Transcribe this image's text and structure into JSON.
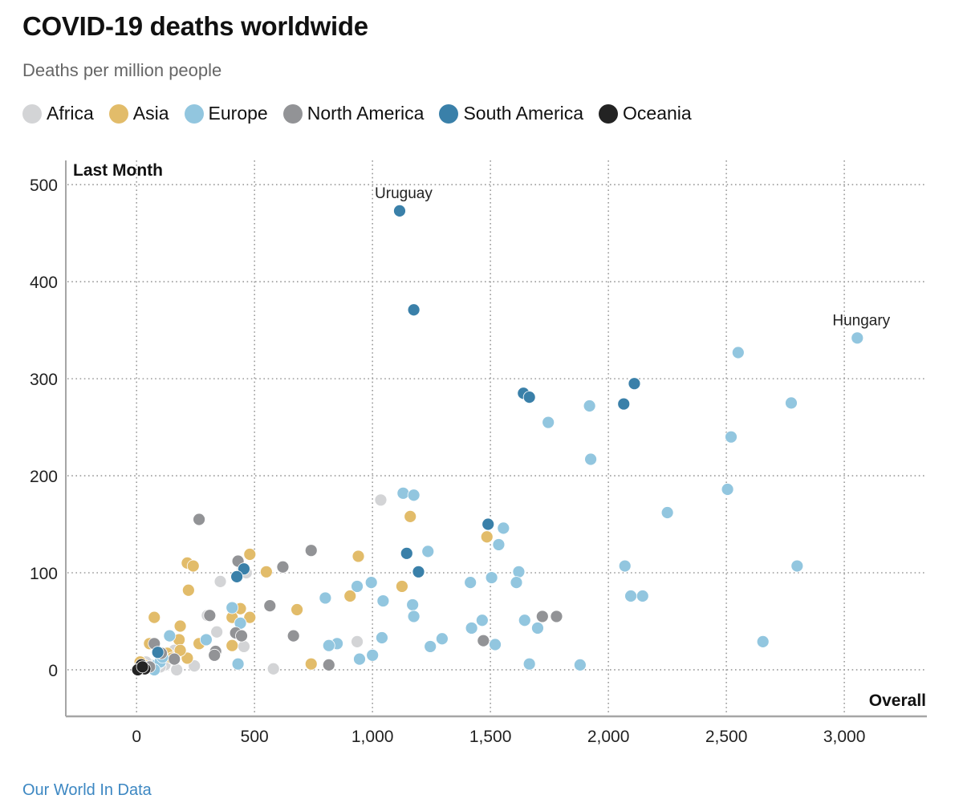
{
  "header": {
    "title": "COVID-19 deaths worldwide",
    "subtitle": "Deaths per million people"
  },
  "legend": [
    {
      "label": "Africa",
      "color": "#d3d4d6"
    },
    {
      "label": "Asia",
      "color": "#e2bc6a"
    },
    {
      "label": "Europe",
      "color": "#92c6df"
    },
    {
      "label": "North America",
      "color": "#929396"
    },
    {
      "label": "South America",
      "color": "#3a80a9"
    },
    {
      "label": "Oceania",
      "color": "#232323"
    }
  ],
  "source": "Our World In Data",
  "chart_data": {
    "type": "scatter",
    "title": "COVID-19 deaths worldwide",
    "subtitle": "Deaths per million people",
    "xlabel": "Overall",
    "ylabel": "Last Month",
    "xlim": [
      -300,
      3350
    ],
    "ylim": [
      -48,
      525
    ],
    "xticks": [
      0,
      500,
      1000,
      1500,
      2000,
      2500,
      3000
    ],
    "xtick_labels": [
      "0",
      "500",
      "1,000",
      "1,500",
      "2,000",
      "2,500",
      "3,000"
    ],
    "yticks": [
      0,
      100,
      200,
      300,
      400,
      500
    ],
    "ytick_labels": [
      "0",
      "100",
      "200",
      "300",
      "400",
      "500"
    ],
    "grid": true,
    "legend_position": "top-left",
    "annotations": [
      {
        "label": "Uruguay",
        "x": 1115,
        "y": 473
      },
      {
        "label": "Hungary",
        "x": 3055,
        "y": 342
      }
    ],
    "series": [
      {
        "name": "Africa",
        "color": "#d3d4d6",
        "points": [
          [
            1035,
            175
          ],
          [
            355,
            91
          ],
          [
            465,
            100
          ],
          [
            450,
            104
          ],
          [
            340,
            39
          ],
          [
            300,
            56
          ],
          [
            455,
            24
          ],
          [
            935,
            29
          ],
          [
            580,
            1
          ],
          [
            160,
            20
          ],
          [
            245,
            4
          ],
          [
            170,
            0
          ],
          [
            120,
            5
          ],
          [
            60,
            5
          ],
          [
            40,
            8
          ],
          [
            150,
            14
          ],
          [
            100,
            3
          ]
        ]
      },
      {
        "name": "Asia",
        "color": "#e2bc6a",
        "points": [
          [
            215,
            110
          ],
          [
            240,
            107
          ],
          [
            220,
            82
          ],
          [
            480,
            119
          ],
          [
            940,
            117
          ],
          [
            1160,
            158
          ],
          [
            1485,
            137
          ],
          [
            550,
            101
          ],
          [
            1125,
            86
          ],
          [
            905,
            76
          ],
          [
            440,
            63
          ],
          [
            405,
            54
          ],
          [
            480,
            54
          ],
          [
            680,
            62
          ],
          [
            185,
            45
          ],
          [
            75,
            54
          ],
          [
            55,
            27
          ],
          [
            265,
            27
          ],
          [
            405,
            25
          ],
          [
            180,
            31
          ],
          [
            740,
            6
          ],
          [
            215,
            12
          ],
          [
            185,
            20
          ],
          [
            130,
            17
          ],
          [
            30,
            5
          ],
          [
            15,
            8
          ],
          [
            60,
            3
          ],
          [
            95,
            7
          ],
          [
            150,
            12
          ]
        ]
      },
      {
        "name": "Europe",
        "color": "#92c6df",
        "points": [
          [
            3055,
            342
          ],
          [
            2550,
            327
          ],
          [
            2775,
            275
          ],
          [
            1920,
            272
          ],
          [
            1745,
            255
          ],
          [
            2520,
            240
          ],
          [
            1925,
            217
          ],
          [
            2505,
            186
          ],
          [
            2250,
            162
          ],
          [
            1130,
            182
          ],
          [
            1175,
            180
          ],
          [
            1555,
            146
          ],
          [
            1535,
            129
          ],
          [
            1235,
            122
          ],
          [
            2070,
            107
          ],
          [
            2800,
            107
          ],
          [
            1620,
            101
          ],
          [
            995,
            90
          ],
          [
            935,
            86
          ],
          [
            1505,
            95
          ],
          [
            1415,
            90
          ],
          [
            1610,
            90
          ],
          [
            2095,
            76
          ],
          [
            2145,
            76
          ],
          [
            800,
            74
          ],
          [
            1045,
            71
          ],
          [
            1170,
            67
          ],
          [
            1175,
            55
          ],
          [
            1645,
            51
          ],
          [
            1465,
            51
          ],
          [
            1700,
            43
          ],
          [
            1420,
            43
          ],
          [
            1295,
            32
          ],
          [
            1040,
            33
          ],
          [
            1245,
            24
          ],
          [
            850,
            27
          ],
          [
            815,
            25
          ],
          [
            945,
            11
          ],
          [
            1000,
            15
          ],
          [
            1520,
            26
          ],
          [
            2655,
            29
          ],
          [
            1665,
            6
          ],
          [
            1880,
            5
          ],
          [
            440,
            48
          ],
          [
            405,
            64
          ],
          [
            295,
            31
          ],
          [
            430,
            6
          ],
          [
            140,
            35
          ],
          [
            85,
            5
          ],
          [
            100,
            8
          ],
          [
            75,
            0
          ],
          [
            110,
            13
          ]
        ]
      },
      {
        "name": "North America",
        "color": "#929396",
        "points": [
          [
            265,
            155
          ],
          [
            740,
            123
          ],
          [
            620,
            106
          ],
          [
            430,
            112
          ],
          [
            565,
            66
          ],
          [
            310,
            56
          ],
          [
            420,
            38
          ],
          [
            445,
            35
          ],
          [
            665,
            35
          ],
          [
            335,
            19
          ],
          [
            330,
            15
          ],
          [
            815,
            5
          ],
          [
            1470,
            30
          ],
          [
            1720,
            55
          ],
          [
            1780,
            55
          ],
          [
            75,
            27
          ],
          [
            160,
            11
          ],
          [
            105,
            17
          ],
          [
            55,
            3
          ]
        ]
      },
      {
        "name": "South America",
        "color": "#3a80a9",
        "points": [
          [
            1115,
            473
          ],
          [
            1175,
            371
          ],
          [
            2110,
            295
          ],
          [
            1640,
            285
          ],
          [
            1665,
            281
          ],
          [
            2065,
            274
          ],
          [
            1490,
            150
          ],
          [
            1145,
            120
          ],
          [
            1195,
            101
          ],
          [
            455,
            104
          ],
          [
            425,
            96
          ],
          [
            90,
            18
          ]
        ]
      },
      {
        "name": "Oceania",
        "color": "#232323",
        "points": [
          [
            10,
            2
          ],
          [
            20,
            5
          ],
          [
            35,
            1
          ],
          [
            5,
            0
          ],
          [
            25,
            3
          ]
        ]
      }
    ]
  }
}
